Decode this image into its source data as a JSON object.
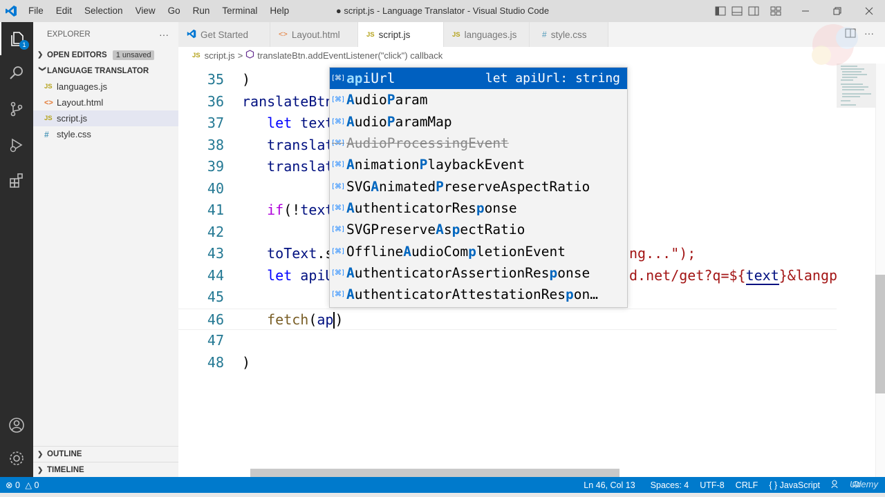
{
  "titlebar": {
    "menu": [
      "File",
      "Edit",
      "Selection",
      "View",
      "Go",
      "Run",
      "Terminal",
      "Help"
    ],
    "window_title": "● script.js - Language Translator - Visual Studio Code"
  },
  "activitybar": {
    "explorer_badge": "1"
  },
  "sidebar": {
    "header": "EXPLORER",
    "more": "···",
    "open_editors": {
      "label": "OPEN EDITORS",
      "badge": "1 unsaved"
    },
    "project": {
      "label": "LANGUAGE TRANSLATOR",
      "files": [
        {
          "icon": "JS",
          "name": "languages.js"
        },
        {
          "icon": "<>",
          "name": "Layout.html"
        },
        {
          "icon": "JS",
          "name": "script.js"
        },
        {
          "icon": "#",
          "name": "style.css"
        }
      ]
    },
    "outline": "OUTLINE",
    "timeline": "TIMELINE"
  },
  "tabs": [
    {
      "icon": "VS",
      "label": "Get Started"
    },
    {
      "icon": "<>",
      "label": "Layout.html"
    },
    {
      "icon": "JS",
      "label": "script.js"
    },
    {
      "icon": "JS",
      "label": "languages.js"
    },
    {
      "icon": "#",
      "label": "style.css"
    }
  ],
  "breadcrumb": {
    "file_icon": "JS",
    "file": "script.js",
    "sep": ">",
    "symbol": "translateBtn.addEventListener(\"click\") callback"
  },
  "editor": {
    "lines": [
      {
        "n": "35",
        "parts": [
          {
            "c": "",
            "t": ")"
          }
        ]
      },
      {
        "n": "36",
        "parts": [
          {
            "c": "var",
            "t": "ranslateBtn"
          }
        ]
      },
      {
        "n": "37",
        "parts": [
          {
            "c": "",
            "t": "   "
          },
          {
            "c": "kw",
            "t": "let"
          },
          {
            "c": "",
            "t": " "
          },
          {
            "c": "var",
            "t": "text"
          }
        ]
      },
      {
        "n": "38",
        "parts": [
          {
            "c": "",
            "t": "   "
          },
          {
            "c": "var",
            "t": "translat"
          }
        ]
      },
      {
        "n": "39",
        "parts": [
          {
            "c": "",
            "t": "   "
          },
          {
            "c": "var",
            "t": "translat"
          }
        ]
      },
      {
        "n": "40",
        "parts": []
      },
      {
        "n": "41",
        "parts": [
          {
            "c": "",
            "t": "   "
          },
          {
            "c": "kw2",
            "t": "if"
          },
          {
            "c": "",
            "t": "(!"
          },
          {
            "c": "var",
            "t": "text"
          }
        ]
      },
      {
        "n": "42",
        "parts": []
      },
      {
        "n": "43",
        "parts": [
          {
            "c": "",
            "t": "   "
          },
          {
            "c": "var",
            "t": "toText"
          },
          {
            "c": "",
            "t": ".s"
          }
        ]
      },
      {
        "n": "44",
        "parts": [
          {
            "c": "",
            "t": "   "
          },
          {
            "c": "kw",
            "t": "let"
          },
          {
            "c": "",
            "t": " "
          },
          {
            "c": "var",
            "t": "apiU"
          }
        ]
      },
      {
        "n": "45",
        "parts": []
      },
      {
        "n": "46",
        "parts": [
          {
            "c": "",
            "t": "   "
          },
          {
            "c": "fn",
            "t": "fetch"
          },
          {
            "c": "",
            "t": "("
          },
          {
            "c": "var",
            "t": "ap"
          },
          {
            "c": "cursor",
            "t": ""
          },
          {
            "c": "",
            "t": ")"
          }
        ]
      },
      {
        "n": "47",
        "parts": []
      },
      {
        "n": "48",
        "parts": [
          {
            "c": "",
            "t": ")"
          }
        ]
      }
    ],
    "line43_tail": "ng...\");",
    "line44_tail_a": "d.net/get?q=${",
    "line44_tail_b": "text",
    "line44_tail_c": "}&langp"
  },
  "suggest": {
    "detail": "let apiUrl: string",
    "items": [
      {
        "segments": [
          {
            "h": true,
            "t": "ap"
          },
          {
            "h": false,
            "t": "iUrl"
          }
        ],
        "focused": true,
        "deprecated": false
      },
      {
        "segments": [
          {
            "h": true,
            "t": "A"
          },
          {
            "h": false,
            "t": "udio"
          },
          {
            "h": true,
            "t": "P"
          },
          {
            "h": false,
            "t": "aram"
          }
        ],
        "focused": false,
        "deprecated": false
      },
      {
        "segments": [
          {
            "h": true,
            "t": "A"
          },
          {
            "h": false,
            "t": "udio"
          },
          {
            "h": true,
            "t": "P"
          },
          {
            "h": false,
            "t": "aramMap"
          }
        ],
        "focused": false,
        "deprecated": false
      },
      {
        "segments": [
          {
            "h": false,
            "t": "AudioProcessingEvent"
          }
        ],
        "focused": false,
        "deprecated": true
      },
      {
        "segments": [
          {
            "h": true,
            "t": "A"
          },
          {
            "h": false,
            "t": "nimation"
          },
          {
            "h": true,
            "t": "P"
          },
          {
            "h": false,
            "t": "laybackEvent"
          }
        ],
        "focused": false,
        "deprecated": false
      },
      {
        "segments": [
          {
            "h": false,
            "t": "SVG"
          },
          {
            "h": true,
            "t": "A"
          },
          {
            "h": false,
            "t": "nimated"
          },
          {
            "h": true,
            "t": "P"
          },
          {
            "h": false,
            "t": "reserveAspectRatio"
          }
        ],
        "focused": false,
        "deprecated": false
      },
      {
        "segments": [
          {
            "h": true,
            "t": "A"
          },
          {
            "h": false,
            "t": "uthenticatorRes"
          },
          {
            "h": true,
            "t": "p"
          },
          {
            "h": false,
            "t": "onse"
          }
        ],
        "focused": false,
        "deprecated": false
      },
      {
        "segments": [
          {
            "h": false,
            "t": "SVGPreserve"
          },
          {
            "h": true,
            "t": "A"
          },
          {
            "h": false,
            "t": "s"
          },
          {
            "h": true,
            "t": "p"
          },
          {
            "h": false,
            "t": "ectRatio"
          }
        ],
        "focused": false,
        "deprecated": false
      },
      {
        "segments": [
          {
            "h": false,
            "t": "Offline"
          },
          {
            "h": true,
            "t": "A"
          },
          {
            "h": false,
            "t": "udioCom"
          },
          {
            "h": true,
            "t": "p"
          },
          {
            "h": false,
            "t": "letionEvent"
          }
        ],
        "focused": false,
        "deprecated": false
      },
      {
        "segments": [
          {
            "h": true,
            "t": "A"
          },
          {
            "h": false,
            "t": "uthenticatorAssertionRes"
          },
          {
            "h": true,
            "t": "p"
          },
          {
            "h": false,
            "t": "onse"
          }
        ],
        "focused": false,
        "deprecated": false
      },
      {
        "segments": [
          {
            "h": true,
            "t": "A"
          },
          {
            "h": false,
            "t": "uthenticatorAttestationRes"
          },
          {
            "h": true,
            "t": "p"
          },
          {
            "h": false,
            "t": "on…"
          }
        ],
        "focused": false,
        "deprecated": false
      }
    ]
  },
  "statusbar": {
    "errors": "0",
    "warnings": "0",
    "position": "Ln 46, Col 13",
    "spaces": "Spaces: 4",
    "encoding": "UTF-8",
    "eol": "CRLF",
    "language": "JavaScript"
  },
  "watermark": "Udemy"
}
